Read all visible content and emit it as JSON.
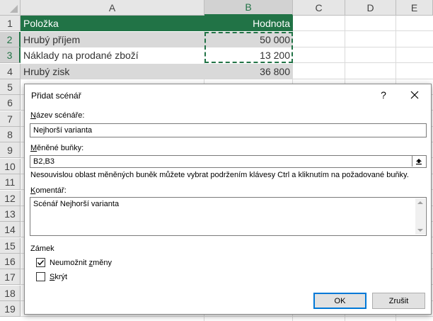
{
  "sheet": {
    "columns": [
      "A",
      "B",
      "C",
      "D",
      "E"
    ],
    "rows": [
      "1",
      "2",
      "3",
      "4",
      "5",
      "6",
      "7",
      "8",
      "9",
      "10",
      "11",
      "12",
      "13",
      "14",
      "15",
      "16",
      "17",
      "18",
      "19"
    ],
    "cells": {
      "a1": "Položka",
      "b1": "Hodnota",
      "a2": "Hrubý příjem",
      "b2": "50 000",
      "a3": "Náklady na prodané zboží",
      "b3": "13 200",
      "a4": "Hrubý zisk",
      "b4": "36 800"
    },
    "colors": {
      "header_green": "#217346",
      "row_gray": "#d9d9d9"
    }
  },
  "dialog": {
    "title": "Přidat scénář",
    "help_label": "?",
    "scenario_name_label_u": "N",
    "scenario_name_label_rest": "ázev scénáře:",
    "scenario_name_value": "Nejhorší varianta",
    "changing_cells_label_u": "M",
    "changing_cells_label_rest": "ěněné buňky:",
    "changing_cells_value": "B2,B3",
    "hint": "Nesouvislou oblast měněných buněk můžete vybrat podržením klávesy Ctrl a kliknutím na požadované buňky.",
    "comment_label_u": "K",
    "comment_label_rest": "omentář:",
    "comment_value": "Scénář Nejhorší varianta",
    "protection_label": "Zámek",
    "prevent_changes_pre": "Neumožnit ",
    "prevent_changes_u": "z",
    "prevent_changes_post": "měny",
    "prevent_changes_checked": true,
    "hide_u": "S",
    "hide_rest": "krýt",
    "hide_checked": false,
    "ok_label": "OK",
    "cancel_label": "Zrušit"
  }
}
